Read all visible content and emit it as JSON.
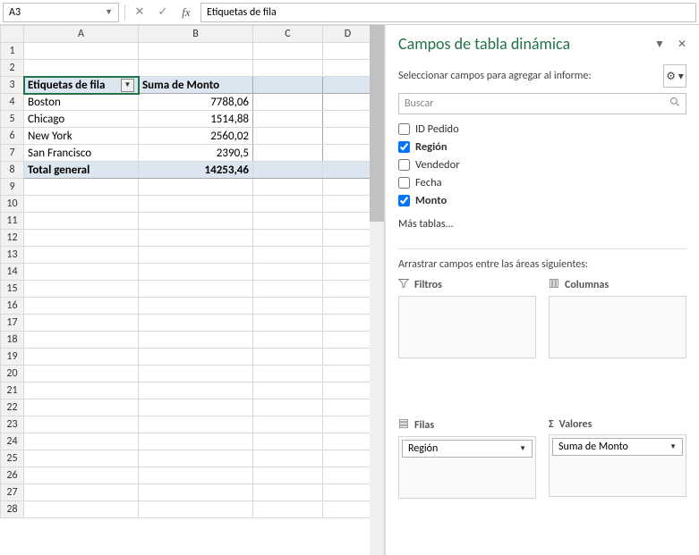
{
  "formula_bar": {
    "cell_ref": "A3",
    "formula": "Etiquetas de fila"
  },
  "columns": [
    "A",
    "B",
    "C",
    "D"
  ],
  "row_count": 28,
  "pivot": {
    "header_row": 3,
    "row_label": "Etiquetas de fila",
    "value_label": "Suma de Monto",
    "data": [
      {
        "label": "Boston",
        "value": "7788,06"
      },
      {
        "label": "Chicago",
        "value": "1514,88"
      },
      {
        "label": "New York",
        "value": "2560,02"
      },
      {
        "label": "San Francisco",
        "value": "2390,5"
      }
    ],
    "total_label": "Total general",
    "total_value": "14253,46"
  },
  "pane": {
    "title": "Campos de tabla dinámica",
    "subtitle": "Seleccionar campos para agregar al informe:",
    "search_placeholder": "Buscar",
    "fields": [
      {
        "name": "ID Pedido",
        "checked": false
      },
      {
        "name": "Región",
        "checked": true
      },
      {
        "name": "Vendedor",
        "checked": false
      },
      {
        "name": "Fecha",
        "checked": false
      },
      {
        "name": "Monto",
        "checked": true
      }
    ],
    "more_tables": "Más tablas...",
    "drag_label": "Arrastrar campos entre las áreas siguientes:",
    "areas": {
      "filters": {
        "title": "Filtros",
        "items": []
      },
      "columns": {
        "title": "Columnas",
        "items": []
      },
      "rows": {
        "title": "Filas",
        "items": [
          "Región"
        ]
      },
      "values": {
        "title": "Valores",
        "items": [
          "Suma de Monto"
        ]
      }
    }
  }
}
